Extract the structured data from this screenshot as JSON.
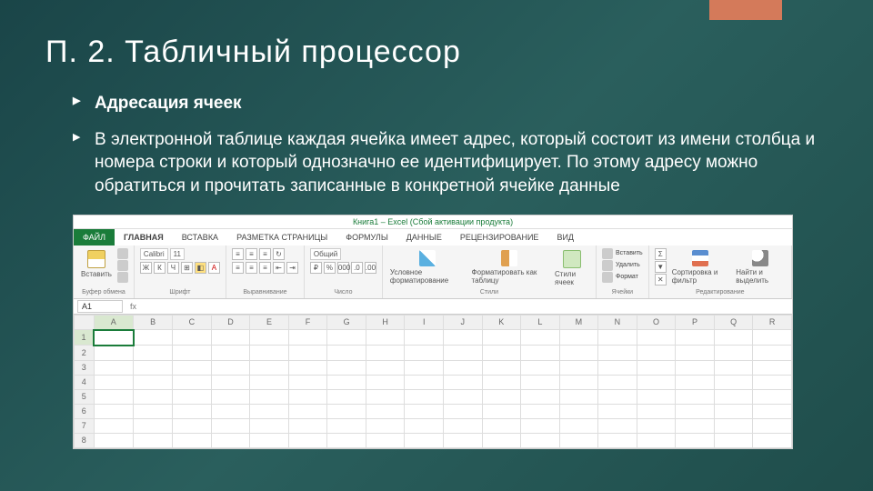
{
  "slide": {
    "title": "П. 2. Табличный процессор",
    "bullets": [
      "Адресация ячеек",
      "В электронной таблице каждая ячейка имеет адрес, который состоит из имени столбца и номера строки и который однозначно ее идентифицирует. По этому адресу можно обратиться и прочитать записанные в конкретной ячейке данные"
    ]
  },
  "excel": {
    "title": "Книга1 – Excel (Сбой активации продукта)",
    "tabs": [
      "ФАЙЛ",
      "ГЛАВНАЯ",
      "ВСТАВКА",
      "РАЗМЕТКА СТРАНИЦЫ",
      "ФОРМУЛЫ",
      "ДАННЫЕ",
      "РЕЦЕНЗИРОВАНИЕ",
      "ВИД"
    ],
    "ribbon": {
      "clipboard": {
        "paste": "Вставить",
        "label": "Буфер обмена"
      },
      "font": {
        "name": "Calibri",
        "size": "11",
        "label": "Шрифт"
      },
      "alignment": {
        "label": "Выравнивание"
      },
      "number": {
        "format": "Общий",
        "label": "Число"
      },
      "styles": {
        "cond": "Условное форматирование",
        "table": "Форматировать как таблицу",
        "cell": "Стили ячеек",
        "label": "Стили"
      },
      "cells": {
        "insert": "Вставить",
        "del": "Удалить",
        "format": "Формат",
        "label": "Ячейки"
      },
      "editing": {
        "sort": "Сортировка и фильтр",
        "find": "Найти и выделить",
        "label": "Редактирование"
      }
    },
    "active_cell": "A1",
    "columns": [
      "A",
      "B",
      "C",
      "D",
      "E",
      "F",
      "G",
      "H",
      "I",
      "J",
      "K",
      "L",
      "M",
      "N",
      "O",
      "P",
      "Q",
      "R"
    ],
    "rows": [
      "1",
      "2",
      "3",
      "4",
      "5",
      "6",
      "7",
      "8"
    ]
  }
}
